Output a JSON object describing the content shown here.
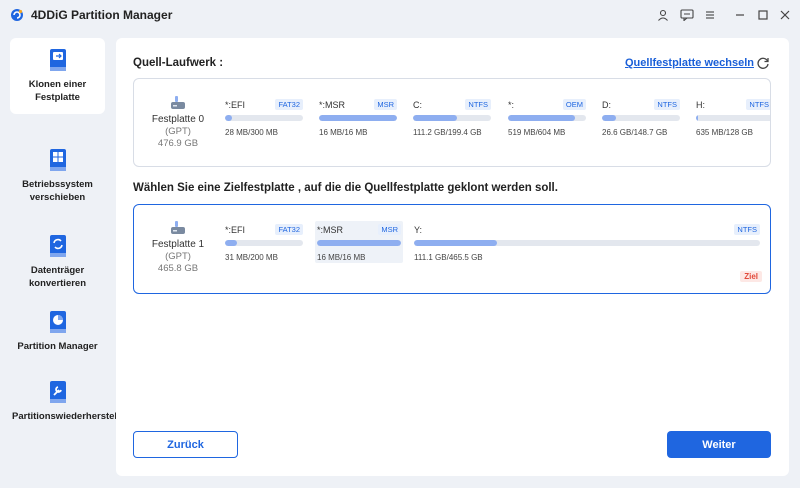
{
  "app": {
    "title": "4DDiG Partition Manager"
  },
  "window_controls": [
    "user-icon",
    "feedback-icon",
    "menu-icon",
    "minimize-icon",
    "maximize-icon",
    "close-icon"
  ],
  "sidebar": {
    "items": [
      {
        "label": "Klonen einer Festplatte",
        "icon": "clone-disk-icon",
        "active": true
      },
      {
        "label": "Betriebssystem verschieben",
        "icon": "migrate-os-icon",
        "active": false
      },
      {
        "label": "Datenträger konvertieren",
        "icon": "convert-disk-icon",
        "active": false
      },
      {
        "label": "Partition Manager",
        "icon": "partition-manager-icon",
        "active": false
      },
      {
        "label": "Partitionswiederherstellung",
        "icon": "partition-recovery-icon",
        "active": false
      }
    ]
  },
  "source": {
    "heading": "Quell-Laufwerk :",
    "switch_label": "Quellfestplatte wechseln",
    "disk": {
      "name": "Festplatte 0",
      "type": "(GPT)",
      "size": "476.9 GB"
    },
    "partitions": [
      {
        "label": "*:EFI",
        "fs": "FAT32",
        "size": "28 MB/300 MB",
        "used": 0.09
      },
      {
        "label": "*:MSR",
        "fs": "MSR",
        "size": "16 MB/16 MB",
        "used": 1.0
      },
      {
        "label": "C:",
        "fs": "NTFS",
        "size": "111.2 GB/199.4 GB",
        "used": 0.56
      },
      {
        "label": "*:",
        "fs": "OEM",
        "size": "519 MB/604 MB",
        "used": 0.86
      },
      {
        "label": "D:",
        "fs": "NTFS",
        "size": "26.6 GB/148.7 GB",
        "used": 0.18
      },
      {
        "label": "H:",
        "fs": "NTFS",
        "size": "635 MB/128 GB",
        "used": 0.005
      }
    ]
  },
  "target": {
    "heading": "Wählen Sie eine Zielfestplatte , auf die die Quellfestplatte geklont werden soll.",
    "disk": {
      "name": "Festplatte 1",
      "type": "(GPT)",
      "size": "465.8 GB"
    },
    "badge": "Ziel",
    "partitions": [
      {
        "label": "*:EFI",
        "fs": "FAT32",
        "size": "31 MB/200 MB",
        "used": 0.155
      },
      {
        "label": "*:MSR",
        "fs": "MSR",
        "size": "16 MB/16 MB",
        "used": 1.0
      },
      {
        "label": "Y:",
        "fs": "NTFS",
        "size": "111.1 GB/465.5 GB",
        "used": 0.24
      }
    ]
  },
  "buttons": {
    "back": "Zurück",
    "next": "Weiter"
  },
  "colors": {
    "accent": "#1f66e0",
    "bar_fill": "#8eaef0",
    "bar_track": "#e3e7ee",
    "badge": "#e24a3b"
  }
}
